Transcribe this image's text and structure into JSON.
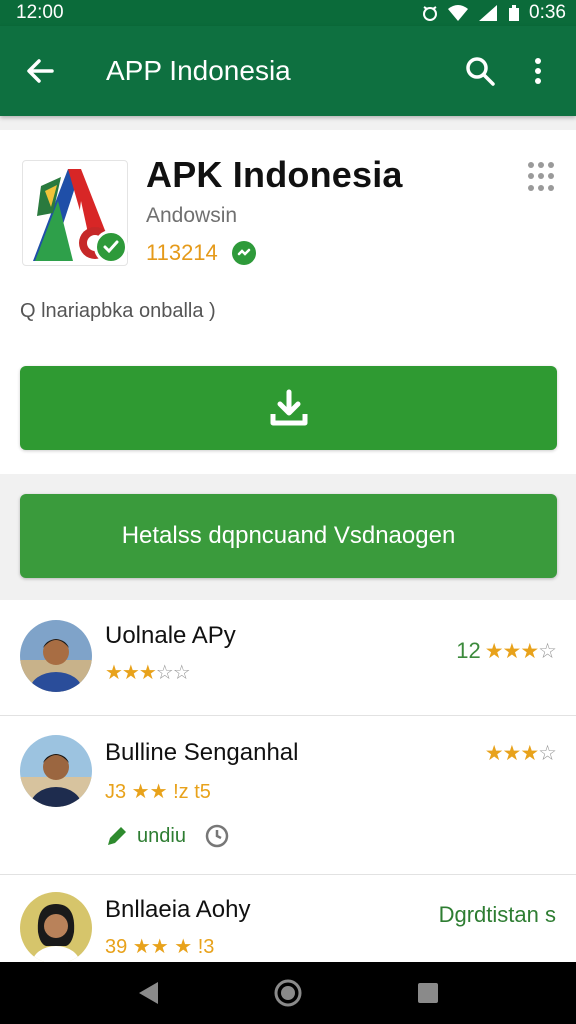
{
  "status_bar": {
    "time": "12:00",
    "right_time": "0:36"
  },
  "app_bar": {
    "title": "APP Indonesia",
    "back_icon": "arrow-left-icon",
    "search_icon": "search-icon",
    "menu_icon": "more-vert-icon"
  },
  "app": {
    "name": "APK Indonesia",
    "developer": "Andowsin",
    "downloads": "113214",
    "subtitle": "Q lnariapbka onballa  )"
  },
  "buttons": {
    "secondary_label": "Hetalss dqpncuand Vsdnaogen"
  },
  "list": [
    {
      "name": "Uolnale APy",
      "rating_filled": 3,
      "rating_total": 5,
      "right_count": "12",
      "right_stars_filled": 3
    },
    {
      "name": "Bulline Senganhal",
      "sub_text": "J3 ★★ !z t5",
      "action_text": "undiu",
      "right_stars_filled": 3
    },
    {
      "name": "Bnllaeia Aohy",
      "sub_text": "39 ★★ ★ !3",
      "right_text": "Dgrdtistan s"
    }
  ],
  "colors": {
    "primary_dark": "#0b6b3a",
    "primary": "#0e7040",
    "button_green": "#2f9a32",
    "star": "#e8a21b"
  }
}
